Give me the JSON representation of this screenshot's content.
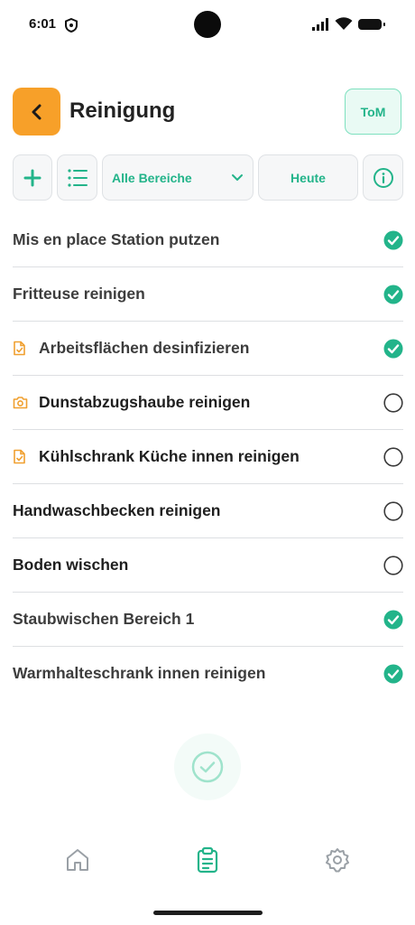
{
  "status_bar": {
    "time": "6:01"
  },
  "header": {
    "title": "Reinigung",
    "user_label": "ToM"
  },
  "toolbar": {
    "area_filter": "Alle Bereiche",
    "date_filter": "Heute"
  },
  "tasks": [
    {
      "label": "Mis en place Station putzen",
      "done": true,
      "lead_icon": ""
    },
    {
      "label": "Fritteuse reinigen",
      "done": true,
      "lead_icon": ""
    },
    {
      "label": "Arbeitsflächen desinfizieren",
      "done": true,
      "lead_icon": "checklist-doc-icon"
    },
    {
      "label": "Dunstabzugshaube reinigen",
      "done": false,
      "lead_icon": "camera-icon"
    },
    {
      "label": "Kühlschrank Küche innen reinigen",
      "done": false,
      "lead_icon": "checklist-doc-icon"
    },
    {
      "label": "Handwaschbecken reinigen",
      "done": false,
      "lead_icon": ""
    },
    {
      "label": "Boden wischen",
      "done": false,
      "lead_icon": ""
    },
    {
      "label": "Staubwischen Bereich 1",
      "done": true,
      "lead_icon": ""
    },
    {
      "label": "Warmhalteschrank innen reinigen",
      "done": true,
      "lead_icon": ""
    }
  ],
  "bottom_nav": {
    "items": [
      "home-icon",
      "clipboard-icon",
      "gear-icon"
    ],
    "active": "clipboard-icon"
  },
  "colors": {
    "accent": "#23b48a",
    "back_button": "#f7a029",
    "lead_icon": "#f0a030",
    "inactive_icon": "#9aa0a6"
  }
}
